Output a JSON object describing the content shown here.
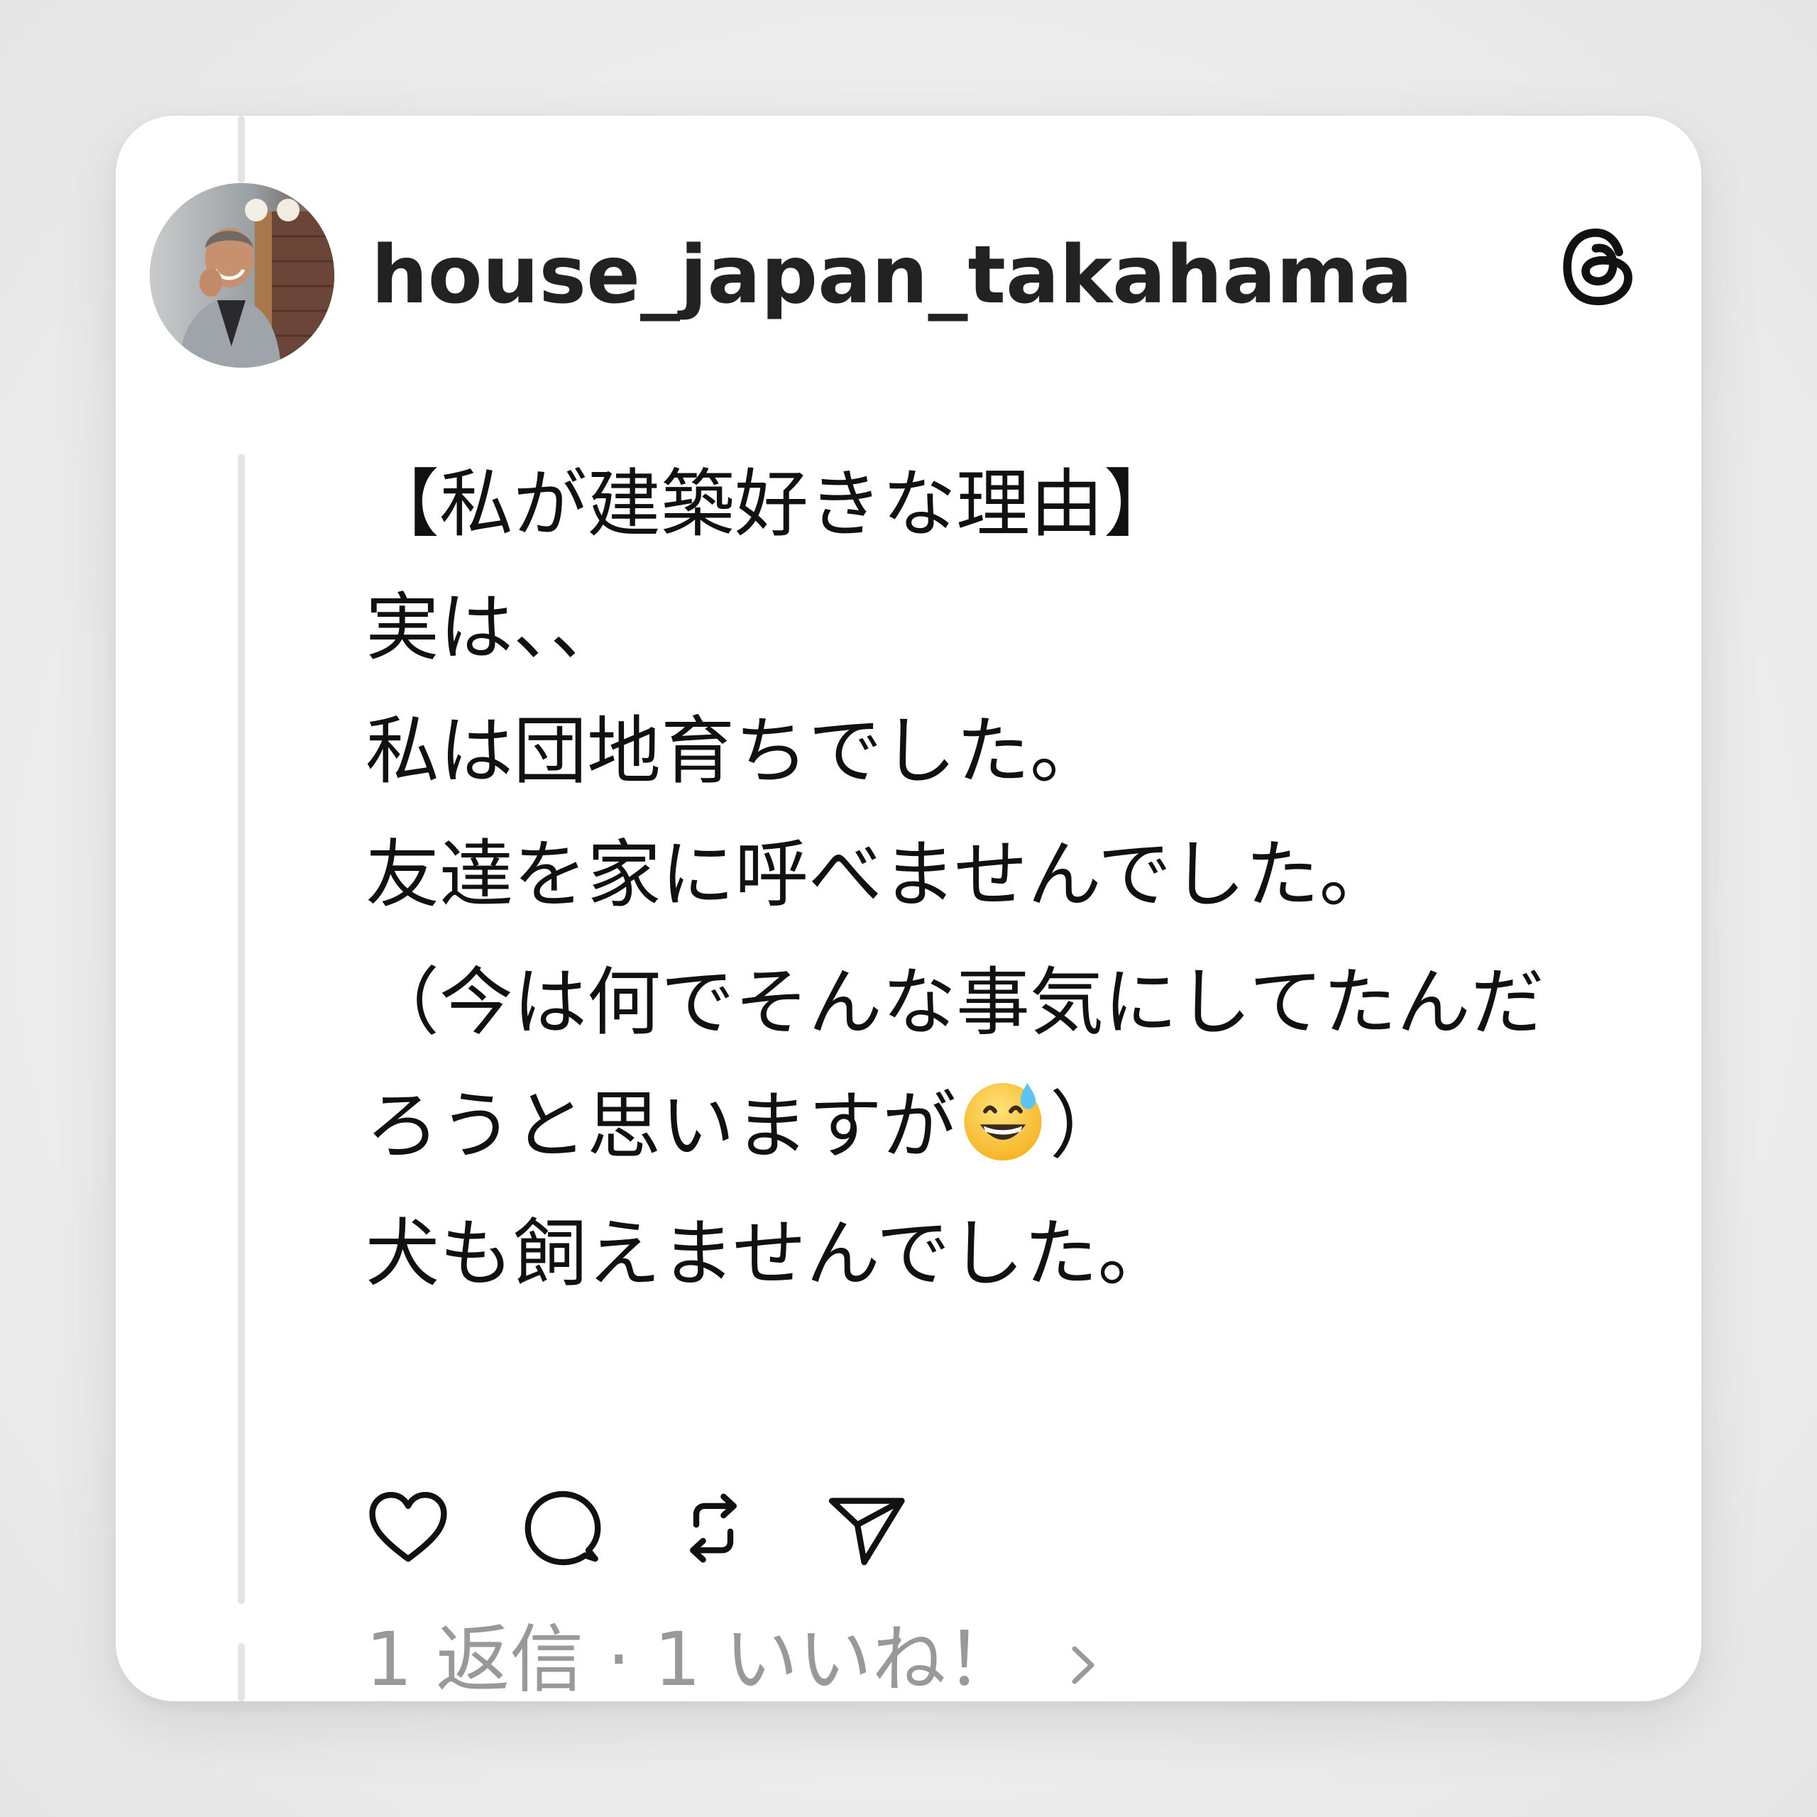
{
  "post": {
    "username": "house_japan_takahama",
    "lines": {
      "l1": "【私が建築好きな理由】",
      "l2": "実は、、",
      "l3": "私は団地育ちでした。",
      "l4": "友達を家に呼べませんでした。",
      "l5": "（今は何でそんな事気にしてたんだ",
      "l6a": "ろうと思いますが",
      "l6b": "）",
      "l7": "犬も飼えませんでした。"
    },
    "emoji": "grinning-face-with-sweat",
    "stats": {
      "replies": "1 返信",
      "separator": "·",
      "likes": "1 いいね！"
    }
  },
  "icons": {
    "logo": "threads-logo-icon",
    "like": "heart-icon",
    "reply": "comment-icon",
    "repost": "repost-icon",
    "share": "send-icon",
    "chevron": "chevron-right-icon"
  },
  "colors": {
    "text": "#111111",
    "muted": "#999999",
    "thread_line": "#e4e4e4",
    "card": "#ffffff",
    "background": "#ebebeb"
  }
}
